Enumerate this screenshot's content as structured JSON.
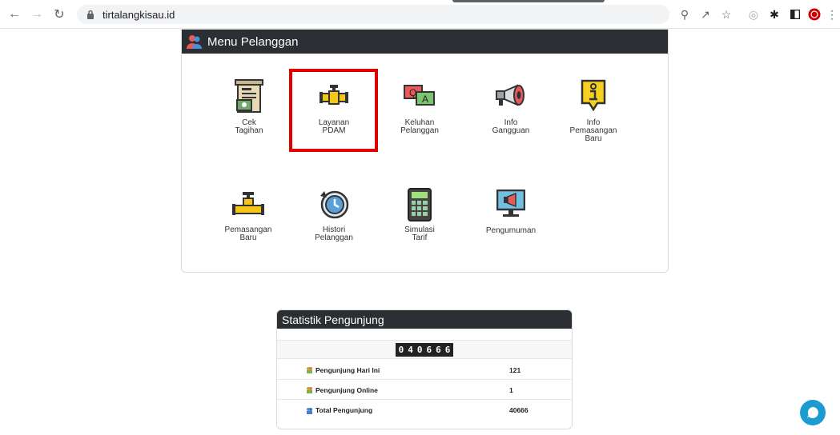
{
  "browser": {
    "url": "tirtalangkisau.id",
    "icons": [
      "back-icon",
      "forward-icon",
      "reload-icon",
      "lock-icon",
      "zoom-icon",
      "share-icon",
      "star-icon",
      "extension-globe-icon",
      "puzzle-icon",
      "sidepanel-icon",
      "profile-icon",
      "more-icon"
    ]
  },
  "menu": {
    "title": "Menu Pelanggan",
    "items": [
      {
        "label": "Cek\nTagihan",
        "icon": "bill-icon"
      },
      {
        "label": "Layanan\nPDAM",
        "icon": "pipe-service-icon"
      },
      {
        "label": "Keluhan\nPelanggan",
        "icon": "chat-qa-icon"
      },
      {
        "label": "Info\nGangguan",
        "icon": "megaphone-icon"
      },
      {
        "label": "Info\nPemasangan\nBaru",
        "icon": "info-icon"
      },
      {
        "label": "Pemasangan\nBaru",
        "icon": "pipe-install-icon"
      },
      {
        "label": "Histori\nPelanggan",
        "icon": "history-icon"
      },
      {
        "label": "Simulasi\nTarif",
        "icon": "calculator-icon"
      },
      {
        "label": "Pengumuman",
        "icon": "announcement-monitor-icon"
      }
    ]
  },
  "stats": {
    "title": "Statistik Pengunjung",
    "counter_digits": [
      "0",
      "4",
      "0",
      "6",
      "6",
      "6"
    ],
    "rows": [
      {
        "label": "Pengunjung Hari Ini",
        "value": "121"
      },
      {
        "label": "Pengunjung Online",
        "value": "1"
      },
      {
        "label": "Total Pengunjung",
        "value": "40666"
      }
    ]
  },
  "colors": {
    "header_dark": "#2b2f33",
    "highlight": "#e00000",
    "chat": "#1a9bd1"
  }
}
